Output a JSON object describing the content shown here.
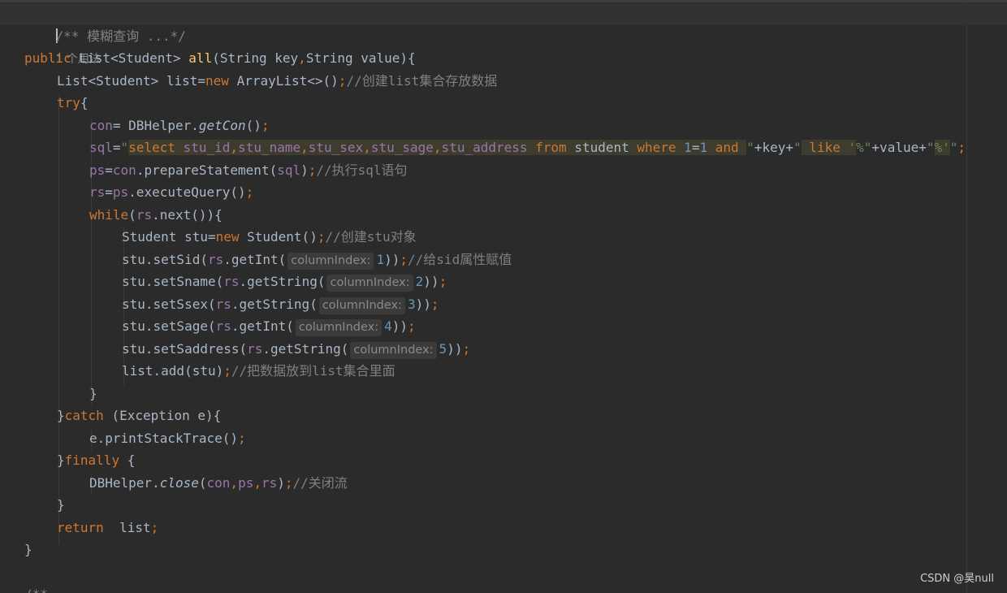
{
  "editor": {
    "doc_comment": "/** 模糊查询 ...*/",
    "usages": "1 个用法",
    "hint_label": "columnIndex:",
    "comments": {
      "create_list": "//创建list集合存放数据",
      "exec_sql": "//执行sql语句",
      "create_stu": "//创建stu对象",
      "set_sid": "//给sid属性赋值",
      "add_list": "//把数据放到list集合里面",
      "close": "//关闭流",
      "next_comment": "/**"
    }
  },
  "watermark": "CSDN @昊null"
}
